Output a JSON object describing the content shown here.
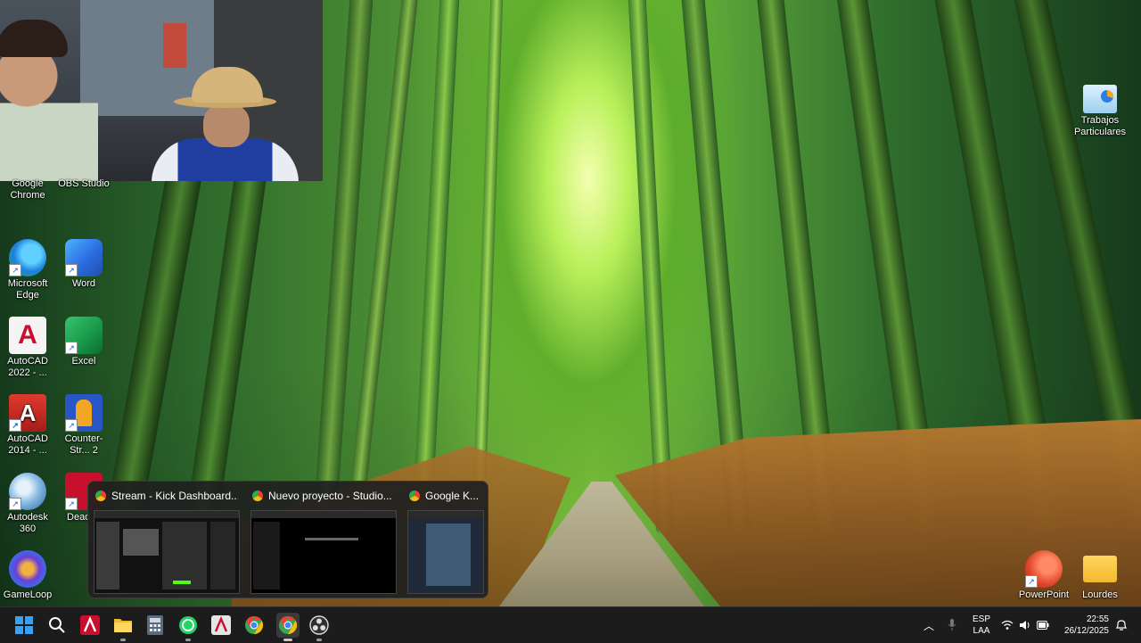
{
  "desktop": {
    "left_icons": [
      {
        "name": "google-chrome-shortcut",
        "label": "Google Chrome",
        "icon": "chrome-icon"
      },
      {
        "name": "obs-studio-shortcut",
        "label": "OBS Studio",
        "icon": "obs-icon"
      },
      {
        "name": "microsoft-edge-shortcut",
        "label": "Microsoft Edge",
        "icon": "edge-icon"
      },
      {
        "name": "word-shortcut",
        "label": "Word",
        "icon": "word-icon"
      },
      {
        "name": "autocad-2022-shortcut",
        "label": "AutoCAD 2022 - ...",
        "icon": "autocad-icon"
      },
      {
        "name": "excel-shortcut",
        "label": "Excel",
        "icon": "excel-icon"
      },
      {
        "name": "autocad-2014-shortcut",
        "label": "AutoCAD 2014 - ...",
        "icon": "autocad-icon"
      },
      {
        "name": "counter-strike-2-shortcut",
        "label": "Counter-Str... 2",
        "icon": "counter-strike-icon"
      },
      {
        "name": "autodesk-360-shortcut",
        "label": "Autodesk 360",
        "icon": "autodesk-360-icon"
      },
      {
        "name": "dead-island-shortcut",
        "label": "Dead Is",
        "icon": "dead-island-icon"
      },
      {
        "name": "gameloop-shortcut",
        "label": "GameLoop",
        "icon": "gameloop-icon"
      }
    ],
    "right_icons": [
      {
        "name": "trabajos-particulares-shortcut",
        "label": "Trabajos Particulares",
        "icon": "presentation-icon"
      },
      {
        "name": "powerpoint-shortcut",
        "label": "PowerPoint",
        "icon": "powerpoint-icon"
      },
      {
        "name": "lourdes-folder",
        "label": "Lourdes",
        "icon": "folder-icon"
      }
    ]
  },
  "taskbar_preview": {
    "windows": [
      {
        "title": "Stream - Kick Dashboard..."
      },
      {
        "title": "Nuevo proyecto - Studio..."
      },
      {
        "title": "Google K..."
      }
    ]
  },
  "taskbar": {
    "apps": [
      {
        "name": "start-button",
        "icon": "windows-start-icon"
      },
      {
        "name": "search-button",
        "icon": "search-icon"
      },
      {
        "name": "autocad-taskbar-button",
        "icon": "autocad-icon"
      },
      {
        "name": "file-explorer-taskbar-button",
        "icon": "folder-icon"
      },
      {
        "name": "calculator-taskbar-button",
        "icon": "calculator-icon"
      },
      {
        "name": "whatsapp-taskbar-button",
        "icon": "whatsapp-icon"
      },
      {
        "name": "acrobat-taskbar-button",
        "icon": "acrobat-icon"
      },
      {
        "name": "chrome-taskbar-button",
        "icon": "chrome-icon"
      },
      {
        "name": "chrome-profile-taskbar-button",
        "icon": "chrome-icon"
      },
      {
        "name": "obs-taskbar-button",
        "icon": "obs-icon"
      }
    ],
    "tray": {
      "lang_line1": "ESP",
      "lang_line2": "LAA",
      "time": "22:55",
      "date": "26/12/2025"
    }
  },
  "colors": {
    "taskbar_bg": "#1c1c1c",
    "accent": "#0078d4"
  }
}
